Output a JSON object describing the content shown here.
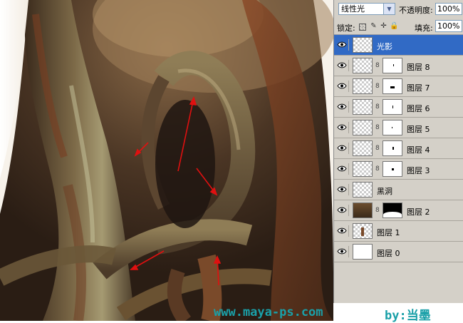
{
  "layers_panel": {
    "blend_mode": "线性光",
    "opacity_label": "不透明度:",
    "opacity_value": "100%",
    "lock_label": "锁定:",
    "fill_label": "填充:",
    "fill_value": "100%",
    "layers": [
      {
        "name": "光影",
        "selected": true,
        "thumb": "transparent",
        "mask": null
      },
      {
        "name": "图层 8",
        "selected": false,
        "thumb": "transparent",
        "mask": "small-mark"
      },
      {
        "name": "图层 7",
        "selected": false,
        "thumb": "transparent",
        "mask": "small-mark"
      },
      {
        "name": "图层 6",
        "selected": false,
        "thumb": "transparent",
        "mask": "small-mark"
      },
      {
        "name": "图层 5",
        "selected": false,
        "thumb": "transparent",
        "mask": "small-mark"
      },
      {
        "name": "图层 4",
        "selected": false,
        "thumb": "transparent",
        "mask": "small-mark"
      },
      {
        "name": "图层 3",
        "selected": false,
        "thumb": "transparent",
        "mask": "small-mark"
      },
      {
        "name": "黑洞",
        "selected": false,
        "thumb": "transparent",
        "mask": null
      },
      {
        "name": "图层 2",
        "selected": false,
        "thumb": "artwork",
        "mask": "black-mask"
      },
      {
        "name": "图层 1",
        "selected": false,
        "thumb": "figure",
        "mask": null
      },
      {
        "name": "图层 0",
        "selected": false,
        "thumb": "white",
        "mask": null
      }
    ]
  },
  "watermark": {
    "url": "www.maya-ps.com",
    "author": "by:当墨"
  },
  "icons": {
    "visibility": "eye-icon",
    "link": "chain-link-icon",
    "lock_transparent": "checkerboard-lock-icon",
    "lock_paint": "brush-lock-icon",
    "lock_move": "move-lock-icon",
    "lock_all": "padlock-icon"
  },
  "colors": {
    "selected_row": "#316ac5",
    "panel_bg": "#d4d0c8",
    "watermark": "#1aa0a8",
    "arrows": "#e01010"
  }
}
